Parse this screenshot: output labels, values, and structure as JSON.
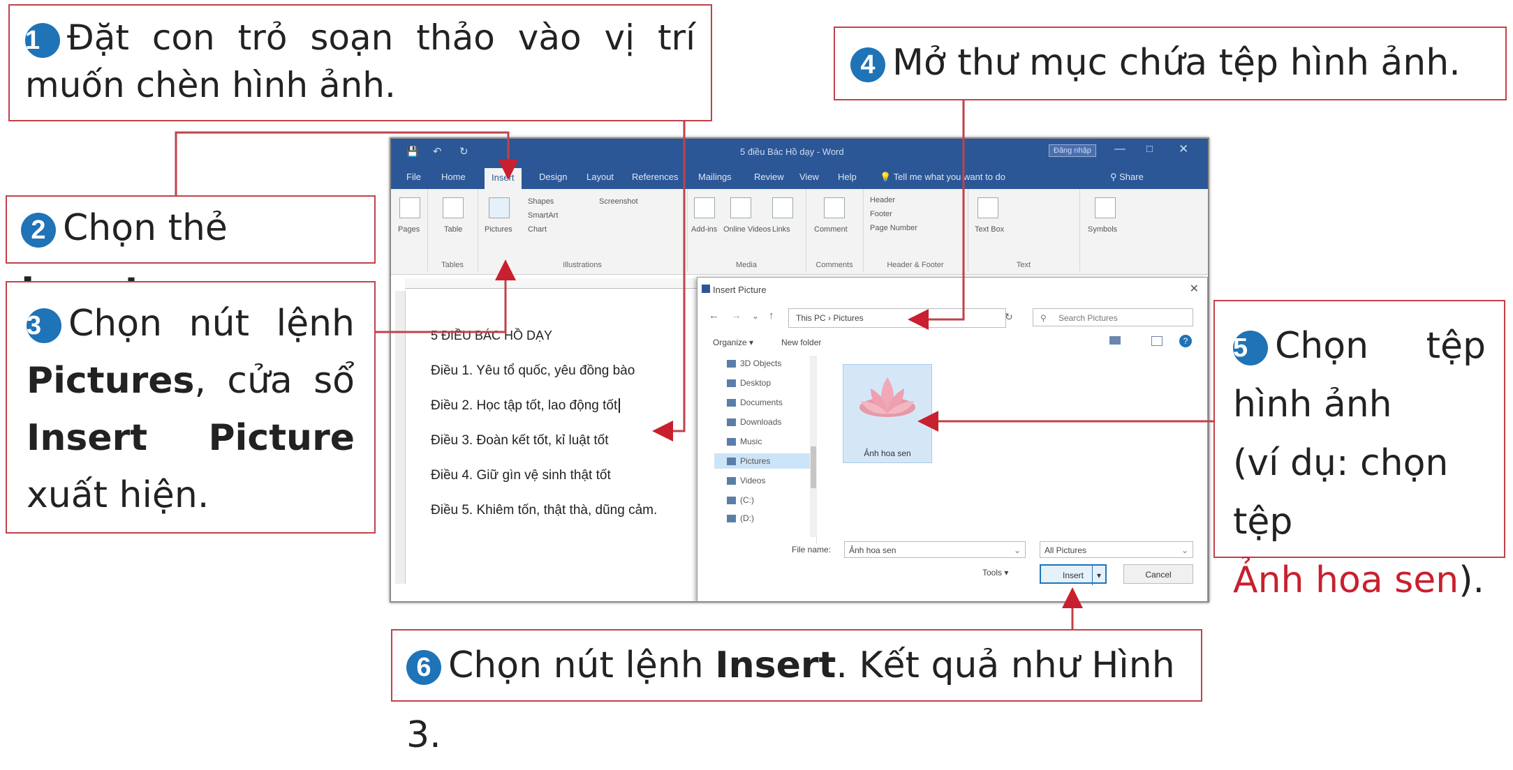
{
  "callouts": {
    "c1": {
      "num": "1",
      "line1": "Đặt con trỏ soạn thảo vào vị trí",
      "line2": "muốn chèn hình ảnh."
    },
    "c2": {
      "num": "2",
      "pre": "Chọn thẻ ",
      "bold": "Insert",
      "post": "."
    },
    "c3": {
      "num": "3",
      "line1": "Chọn nút lệnh",
      "bold1": "Pictures",
      "line2_rest": ", cửa sổ",
      "bold2a": "Insert",
      "bold2b": "Picture",
      "line4": "xuất hiện."
    },
    "c4": {
      "num": "4",
      "text": "Mở thư mục chứa tệp hình ảnh."
    },
    "c5": {
      "num": "5",
      "line1": "Chọn tệp",
      "line2": "hình ảnh",
      "line3": "(ví dụ: chọn tệp",
      "red": "Ảnh hoa sen",
      "line4_rest": ")."
    },
    "c6": {
      "num": "6",
      "pre": "Chọn nút lệnh ",
      "bold": "Insert",
      "post": ". Kết quả như Hình 3."
    }
  },
  "colors": {
    "accent_blue": "#1f73b7",
    "callout_border": "#c0424a",
    "word_blue": "#2b5797",
    "highlight_red": "#c8202e"
  },
  "word": {
    "title": "5 điều Bác Hồ dạy - Word",
    "user": "Đăng nhập",
    "share": "Share",
    "tabs": [
      "File",
      "Home",
      "Insert",
      "Design",
      "Layout",
      "References",
      "Mailings",
      "Review",
      "View",
      "Help",
      "Tell me what you want to do"
    ],
    "ribbon": {
      "pages": "Pages",
      "table": "Table",
      "tables_group": "Tables",
      "pictures": "Pictures",
      "shapes": "Shapes",
      "screenshot": "Screenshot",
      "smartart": "SmartArt",
      "chart": "Chart",
      "illustrations_group": "Illustrations",
      "addins": "Add-ins",
      "online_videos": "Online Videos",
      "media_group": "Media",
      "links": "Links",
      "comment": "Comment",
      "comments_group": "Comments",
      "header": "Header",
      "footer": "Footer",
      "page_number": "Page Number",
      "header_footer_group": "Header & Footer",
      "textbox": "Text Box",
      "text_group": "Text",
      "symbols": "Symbols"
    },
    "doc": {
      "heading": "5 ĐIỀU BÁC HỒ DẠY",
      "lines": [
        "Điều 1. Yêu tổ quốc, yêu đồng bào",
        "Điều 2. Học tập tốt, lao động tốt",
        "Điều 3. Đoàn kết tốt, kỉ luật tốt",
        "Điều 4. Giữ gìn vệ sinh thật tốt",
        "Điều 5. Khiêm tốn, thật thà, dũng cảm."
      ]
    }
  },
  "dialog": {
    "title": "Insert Picture",
    "address": "This PC  ›  Pictures",
    "search_placeholder": "Search Pictures",
    "organize": "Organize ▾",
    "new_folder": "New folder",
    "nav": [
      "3D Objects",
      "Desktop",
      "Documents",
      "Downloads",
      "Music",
      "Pictures",
      "Videos",
      "(C:)",
      "(D:)"
    ],
    "file_label": "Ảnh hoa sen",
    "filename_label": "File name:",
    "filename_value": "Ảnh hoa sen",
    "filetype": "All Pictures",
    "tools": "Tools ▾",
    "insert": "Insert",
    "cancel": "Cancel"
  }
}
